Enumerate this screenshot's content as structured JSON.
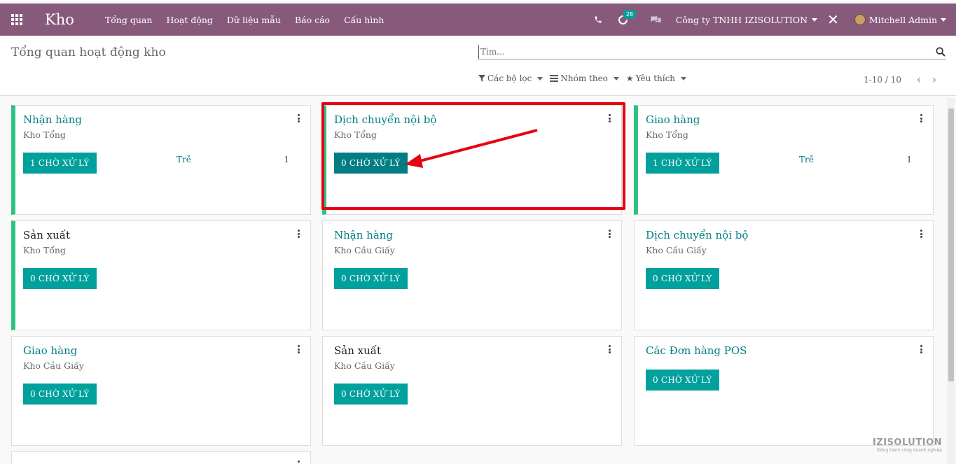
{
  "app": {
    "name": "Kho"
  },
  "nav": {
    "menu": [
      "Tổng quan",
      "Hoạt động",
      "Dữ liệu mẫu",
      "Báo cáo",
      "Cấu hình"
    ],
    "activity_count": "28",
    "company": "Công ty TNHH IZISOLUTION",
    "user": "Mitchell Admin"
  },
  "control": {
    "breadcrumb": "Tổng quan hoạt động kho",
    "search_placeholder": "Tìm...",
    "filters_label": "Các bộ lọc",
    "group_label": "Nhóm theo",
    "favorites_label": "Yêu thích",
    "pager": "1-10 / 10"
  },
  "cards": [
    {
      "title": "Nhận hàng",
      "subtitle": "Kho Tổng",
      "button": "1 CHỜ XỬ LÝ",
      "late_label": "Trễ",
      "late_count": "1"
    },
    {
      "title": "Dịch chuyển nội bộ",
      "subtitle": "Kho Tổng",
      "button": "0 CHỜ XỬ LÝ"
    },
    {
      "title": "Giao hàng",
      "subtitle": "Kho Tổng",
      "button": "1 CHỜ XỬ LÝ",
      "late_label": "Trễ",
      "late_count": "1"
    },
    {
      "title": "Sản xuất",
      "subtitle": "Kho Tổng",
      "button": "0 CHỜ XỬ LÝ"
    },
    {
      "title": "Nhận hàng",
      "subtitle": "Kho Cầu Giấy",
      "button": "0 CHỜ XỬ LÝ"
    },
    {
      "title": "Dịch chuyển nội bộ",
      "subtitle": "Kho Cầu Giấy",
      "button": "0 CHỜ XỬ LÝ"
    },
    {
      "title": "Giao hàng",
      "subtitle": "Kho Cầu Giấy",
      "button": "0 CHỜ XỬ LÝ"
    },
    {
      "title": "Sản xuất",
      "subtitle": "Kho Cầu Giấy",
      "button": "0 CHỜ XỬ LÝ"
    },
    {
      "title": "Các Đơn hàng POS",
      "subtitle": "",
      "button": "0 CHỜ XỬ LÝ"
    }
  ],
  "watermark": {
    "name": "IZISOLUTION",
    "tagline": "Đồng hành cùng doanh nghiệp"
  },
  "colors": {
    "navbar": "#875a7b",
    "primary": "#00a09d",
    "accent": "#2fc183",
    "annotation": "#e60012"
  }
}
